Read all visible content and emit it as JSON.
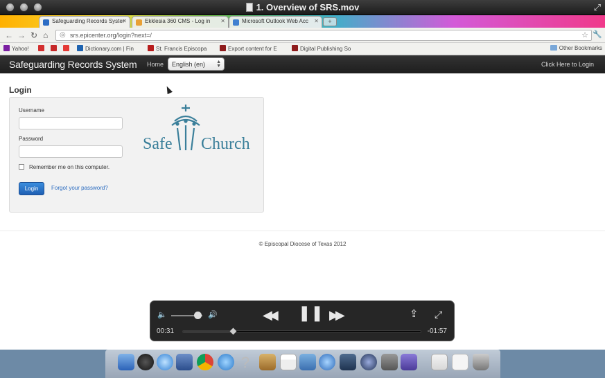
{
  "window": {
    "title": "1. Overview of SRS.mov"
  },
  "browser": {
    "tabs": [
      {
        "label": "Safeguarding Records Syster",
        "active": true,
        "color": "#2b6cc4"
      },
      {
        "label": "Ekklesia 360 CMS - Log in",
        "active": false,
        "color": "#e9a035"
      },
      {
        "label": "Microsoft Outlook Web Acc",
        "active": false,
        "color": "#3f7fd0"
      }
    ],
    "url": "srs.epicenter.org/login?next=/",
    "bookmarks": [
      {
        "label": "Yahoo!",
        "color": "#7b1fa2"
      },
      {
        "label": "",
        "color": "#d32f2f"
      },
      {
        "label": "",
        "color": "#c62828"
      },
      {
        "label": "",
        "color": "#e53935"
      },
      {
        "label": "Dictionary.com | Fin",
        "color": "#1e63b0"
      },
      {
        "label": "St. Francis Episcopa",
        "color": "#b71c1c"
      },
      {
        "label": "Export content for E",
        "color": "#8e1b1b"
      },
      {
        "label": "Digital Publishing So",
        "color": "#8e1b1b"
      }
    ],
    "other_bookmarks": "Other Bookmarks"
  },
  "site": {
    "brand": "Safeguarding Records System",
    "nav_home": "Home",
    "language": "English (en)",
    "login_link": "Click Here to Login"
  },
  "login": {
    "title": "Login",
    "username_label": "Username",
    "password_label": "Password",
    "remember_label": "Remember me on this computer.",
    "button": "Login",
    "forgot": "Forgot your password?",
    "logo_text_left": "Safe",
    "logo_text_right": "Church"
  },
  "footer": {
    "copyright": "© Episcopal Diocese of Texas 2012"
  },
  "player": {
    "elapsed": "00:31",
    "remaining": "-01:57",
    "progress": 0.21,
    "volume": 0.85
  },
  "colors": {
    "accent": "#2b6fca",
    "logo": "#3a7f9a"
  }
}
